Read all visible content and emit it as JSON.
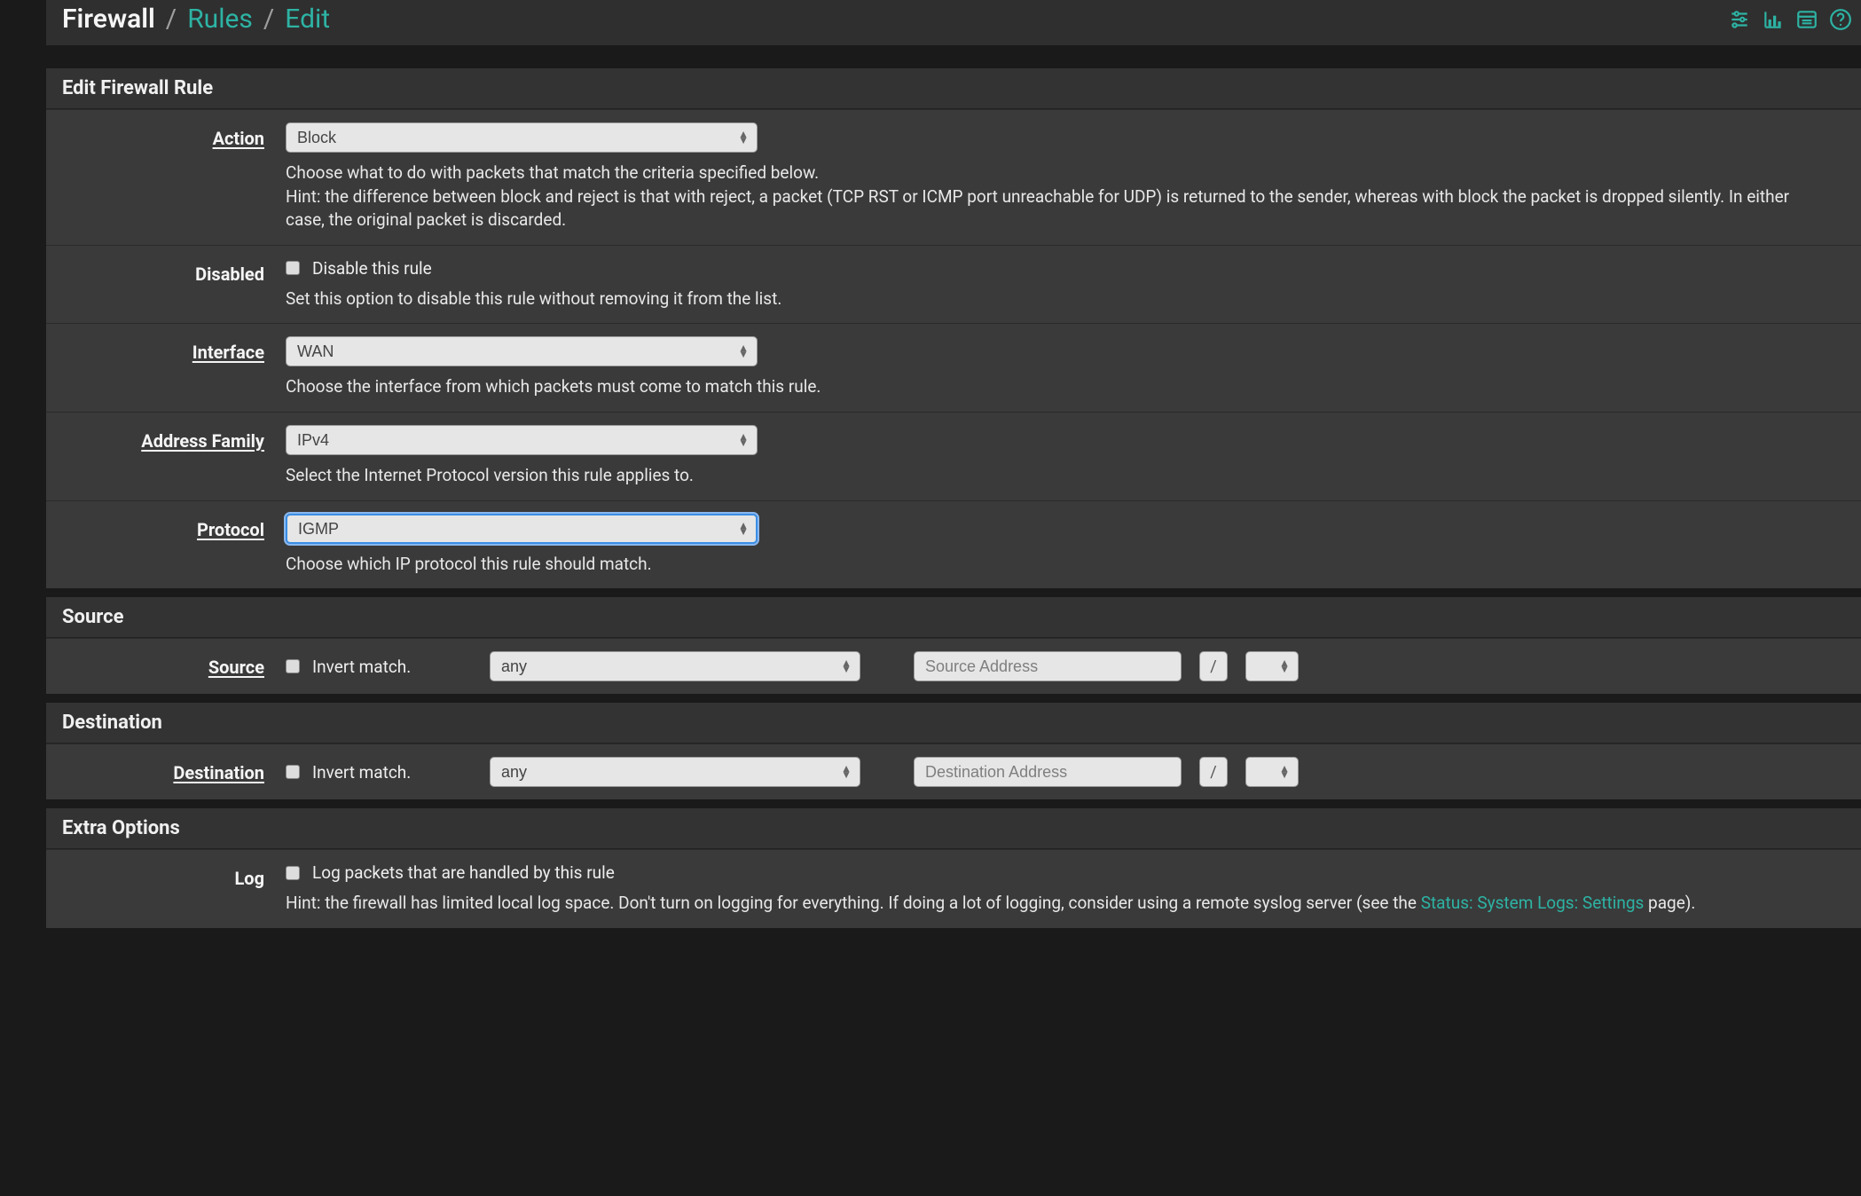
{
  "breadcrumb": {
    "root": "Firewall",
    "mid": "Rules",
    "leaf": "Edit"
  },
  "panels": {
    "edit_rule": {
      "title": "Edit Firewall Rule",
      "action": {
        "label": "Action",
        "value": "Block",
        "help_l1": "Choose what to do with packets that match the criteria specified below.",
        "help_l2": "Hint: the difference between block and reject is that with reject, a packet (TCP RST or ICMP port unreachable for UDP) is returned to the sender, whereas with block the packet is dropped silently. In either case, the original packet is discarded."
      },
      "disabled": {
        "label": "Disabled",
        "cb_label": "Disable this rule",
        "checked": false,
        "help": "Set this option to disable this rule without removing it from the list."
      },
      "interface": {
        "label": "Interface",
        "value": "WAN",
        "help": "Choose the interface from which packets must come to match this rule."
      },
      "address_family": {
        "label": "Address Family",
        "value": "IPv4",
        "help": "Select the Internet Protocol version this rule applies to."
      },
      "protocol": {
        "label": "Protocol",
        "value": "IGMP",
        "help": "Choose which IP protocol this rule should match."
      }
    },
    "source": {
      "title": "Source",
      "row": {
        "label": "Source",
        "invert_label": "Invert match.",
        "invert_checked": false,
        "type_value": "any",
        "addr_placeholder": "Source Address",
        "addr_value": "",
        "slash": "/"
      }
    },
    "destination": {
      "title": "Destination",
      "row": {
        "label": "Destination",
        "invert_label": "Invert match.",
        "invert_checked": false,
        "type_value": "any",
        "addr_placeholder": "Destination Address",
        "addr_value": "",
        "slash": "/"
      }
    },
    "extra": {
      "title": "Extra Options",
      "log": {
        "label": "Log",
        "cb_label": "Log packets that are handled by this rule",
        "checked": false,
        "help_pre": "Hint: the firewall has limited local log space. Don't turn on logging for everything. If doing a lot of logging, consider using a remote syslog server (see the ",
        "help_link": "Status: System Logs: Settings",
        "help_post": " page)."
      }
    }
  }
}
